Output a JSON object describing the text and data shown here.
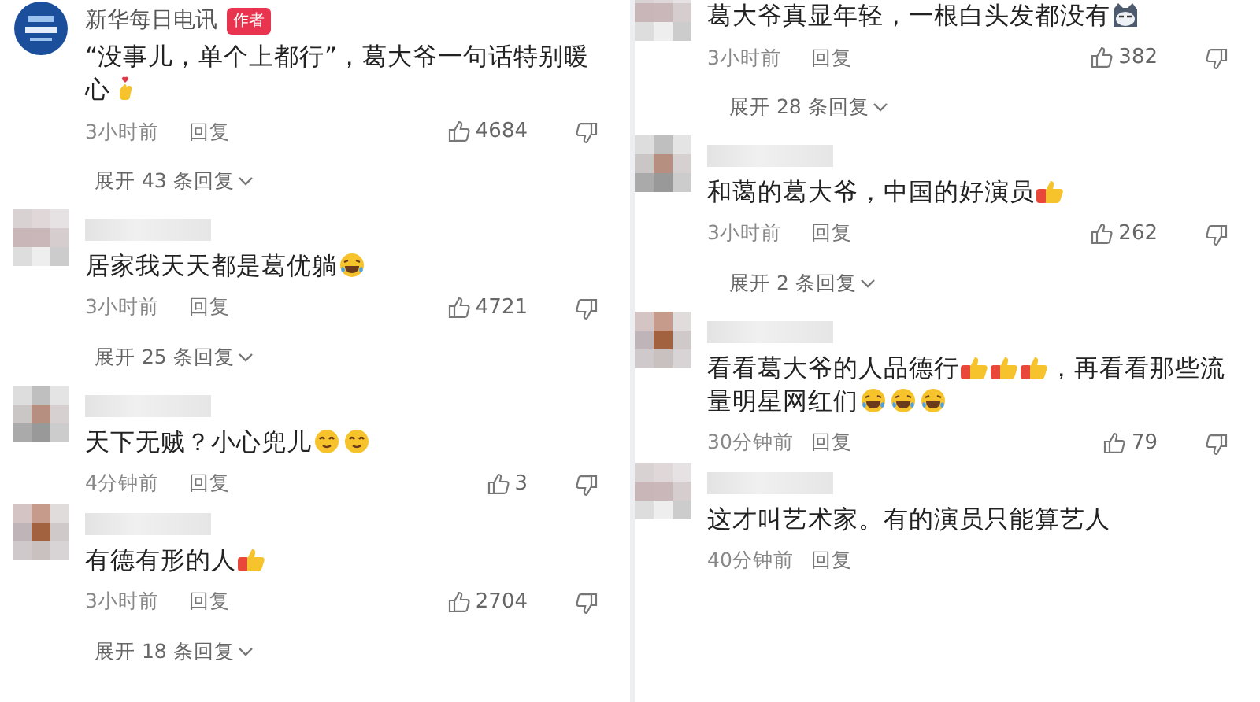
{
  "columns": [
    {
      "comments": [
        {
          "avatar": {
            "kind": "logo"
          },
          "author": "新华每日电讯",
          "badge": "作者",
          "body": [
            {
              "kind": "text",
              "text": "“没事儿，单个上都行”，葛大爷一句话特别暖心"
            },
            {
              "kind": "heart_hand"
            }
          ],
          "time": "3小时前",
          "reply": "回复",
          "likes": "4684",
          "expand": "展开 43 条回复"
        },
        {
          "avatar": {
            "kind": "blurred"
          },
          "body": [
            {
              "kind": "text",
              "text": "居家我天天都是葛优躺"
            },
            {
              "kind": "laugh"
            }
          ],
          "time": "3小时前",
          "reply": "回复",
          "likes": "4721",
          "expand": "展开 25 条回复"
        },
        {
          "avatar": {
            "kind": "blurred"
          },
          "body": [
            {
              "kind": "text",
              "text": "天下无贼？小心兜儿"
            },
            {
              "kind": "smile"
            },
            {
              "kind": "smile"
            }
          ],
          "time": "4分钟前",
          "reply": "回复",
          "likes": "3"
        },
        {
          "avatar": {
            "kind": "blurred"
          },
          "body": [
            {
              "kind": "text",
              "text": "有德有形的人"
            },
            {
              "kind": "thumbs"
            }
          ],
          "time": "3小时前",
          "reply": "回复",
          "likes": "2704",
          "expand": "展开 18 条回复"
        }
      ]
    },
    {
      "comments": [
        {
          "avatar": {
            "kind": "blurred"
          },
          "cut_top": true,
          "body": [
            {
              "kind": "text",
              "text": "葛大爷真显年轻，一根白头发都没有"
            },
            {
              "kind": "cat"
            }
          ],
          "time": "3小时前",
          "reply": "回复",
          "likes": "382",
          "expand": "展开 28 条回复"
        },
        {
          "avatar": {
            "kind": "blurred"
          },
          "body": [
            {
              "kind": "text",
              "text": "和蔼的葛大爷，中国的好演员"
            },
            {
              "kind": "thumbs"
            }
          ],
          "time": "3小时前",
          "reply": "回复",
          "likes": "262",
          "expand": "展开 2 条回复"
        },
        {
          "avatar": {
            "kind": "blurred"
          },
          "body": [
            {
              "kind": "text",
              "text": "看看葛大爷的人品德行"
            },
            {
              "kind": "thumbs"
            },
            {
              "kind": "thumbs"
            },
            {
              "kind": "thumbs"
            },
            {
              "kind": "text",
              "text": "，再看看那些流量明星网红们"
            },
            {
              "kind": "laugh"
            },
            {
              "kind": "laugh"
            },
            {
              "kind": "laugh"
            }
          ],
          "time": "30分钟前",
          "reply": "回复",
          "likes": "79"
        },
        {
          "avatar": {
            "kind": "blurred"
          },
          "body": [
            {
              "kind": "text",
              "text": "这才叫艺术家。有的演员只能算艺人"
            }
          ],
          "time": "40分钟前",
          "reply": "回复"
        }
      ]
    }
  ]
}
